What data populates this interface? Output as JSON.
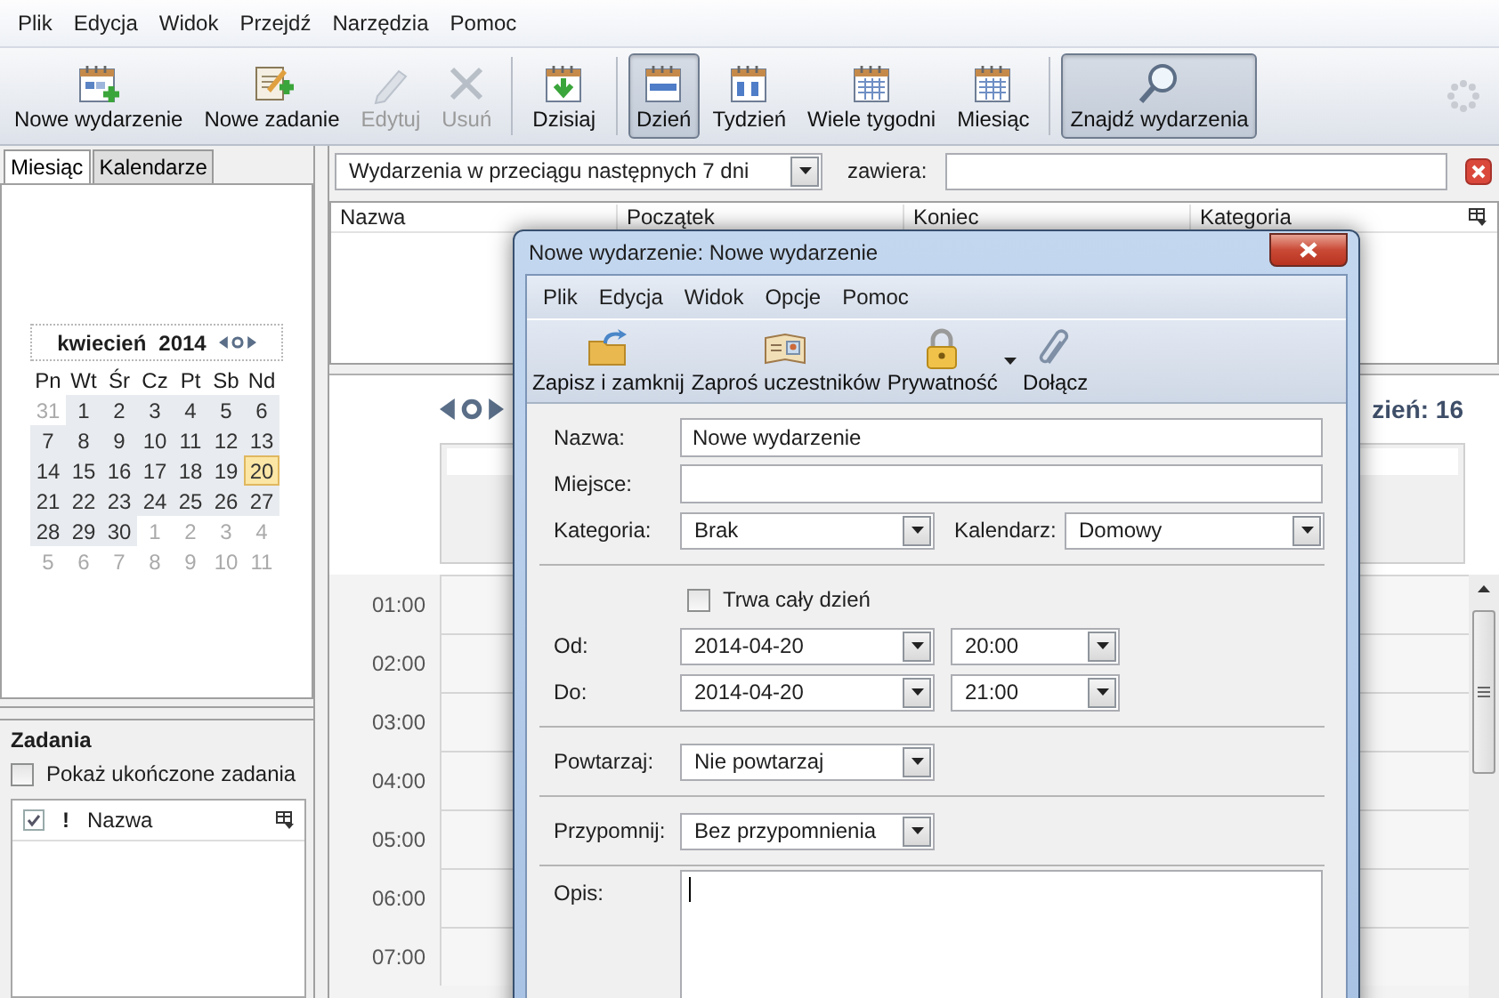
{
  "menu": [
    "Plik",
    "Edycja",
    "Widok",
    "Przejdź",
    "Narzędzia",
    "Pomoc"
  ],
  "toolbar": {
    "groups": [
      [
        {
          "label": "Nowe wydarzenie",
          "disabled": false,
          "selected": false
        },
        {
          "label": "Nowe zadanie",
          "disabled": false,
          "selected": false
        },
        {
          "label": "Edytuj",
          "disabled": true,
          "selected": false
        },
        {
          "label": "Usuń",
          "disabled": true,
          "selected": false
        }
      ],
      [
        {
          "label": "Dzisiaj",
          "disabled": false,
          "selected": false
        }
      ],
      [
        {
          "label": "Dzień",
          "disabled": false,
          "selected": true
        },
        {
          "label": "Tydzień",
          "disabled": false,
          "selected": false
        },
        {
          "label": "Wiele tygodni",
          "disabled": false,
          "selected": false
        },
        {
          "label": "Miesiąc",
          "disabled": false,
          "selected": false
        }
      ],
      [
        {
          "label": "Znajdź wydarzenia",
          "disabled": false,
          "selected": true
        }
      ]
    ]
  },
  "sidebar": {
    "tabs": [
      {
        "label": "Miesiąc",
        "selected": true
      },
      {
        "label": "Kalendarze",
        "selected": false
      }
    ],
    "minimonth": {
      "month": "kwiecień",
      "year": "2014",
      "weekdays": [
        "Pn",
        "Wt",
        "Śr",
        "Cz",
        "Pt",
        "Sb",
        "Nd"
      ],
      "weeks": [
        [
          {
            "day": "31",
            "outside": true,
            "selected": false
          },
          {
            "day": "1",
            "outside": false,
            "selected": false
          },
          {
            "day": "2",
            "outside": false,
            "selected": false
          },
          {
            "day": "3",
            "outside": false,
            "selected": false
          },
          {
            "day": "4",
            "outside": false,
            "selected": false
          },
          {
            "day": "5",
            "outside": false,
            "selected": false
          },
          {
            "day": "6",
            "outside": false,
            "selected": false
          }
        ],
        [
          {
            "day": "7",
            "outside": false,
            "selected": false
          },
          {
            "day": "8",
            "outside": false,
            "selected": false
          },
          {
            "day": "9",
            "outside": false,
            "selected": false
          },
          {
            "day": "10",
            "outside": false,
            "selected": false
          },
          {
            "day": "11",
            "outside": false,
            "selected": false
          },
          {
            "day": "12",
            "outside": false,
            "selected": false
          },
          {
            "day": "13",
            "outside": false,
            "selected": false
          }
        ],
        [
          {
            "day": "14",
            "outside": false,
            "selected": false
          },
          {
            "day": "15",
            "outside": false,
            "selected": false
          },
          {
            "day": "16",
            "outside": false,
            "selected": false
          },
          {
            "day": "17",
            "outside": false,
            "selected": false
          },
          {
            "day": "18",
            "outside": false,
            "selected": false
          },
          {
            "day": "19",
            "outside": false,
            "selected": false
          },
          {
            "day": "20",
            "outside": false,
            "selected": true
          }
        ],
        [
          {
            "day": "21",
            "outside": false,
            "selected": false
          },
          {
            "day": "22",
            "outside": false,
            "selected": false
          },
          {
            "day": "23",
            "outside": false,
            "selected": false
          },
          {
            "day": "24",
            "outside": false,
            "selected": false
          },
          {
            "day": "25",
            "outside": false,
            "selected": false
          },
          {
            "day": "26",
            "outside": false,
            "selected": false
          },
          {
            "day": "27",
            "outside": false,
            "selected": false
          }
        ],
        [
          {
            "day": "28",
            "outside": false,
            "selected": false
          },
          {
            "day": "29",
            "outside": false,
            "selected": false
          },
          {
            "day": "30",
            "outside": false,
            "selected": false
          },
          {
            "day": "1",
            "outside": true,
            "selected": false
          },
          {
            "day": "2",
            "outside": true,
            "selected": false
          },
          {
            "day": "3",
            "outside": true,
            "selected": false
          },
          {
            "day": "4",
            "outside": true,
            "selected": false
          }
        ],
        [
          {
            "day": "5",
            "outside": true,
            "selected": false
          },
          {
            "day": "6",
            "outside": true,
            "selected": false
          },
          {
            "day": "7",
            "outside": true,
            "selected": false
          },
          {
            "day": "8",
            "outside": true,
            "selected": false
          },
          {
            "day": "9",
            "outside": true,
            "selected": false
          },
          {
            "day": "10",
            "outside": true,
            "selected": false
          },
          {
            "day": "11",
            "outside": true,
            "selected": false
          }
        ]
      ]
    },
    "tasks": {
      "title": "Zadania",
      "show_completed": {
        "label": "Pokaż ukończone zadania",
        "checked": false
      },
      "priority_column": "!",
      "name_column": "Nazwa"
    }
  },
  "filter": {
    "value": "Wydarzenia w przeciągu następnych 7 dni",
    "contains_label": "zawiera:"
  },
  "event_list": {
    "columns": [
      "Nazwa",
      "Początek",
      "Koniec",
      "Kategoria"
    ]
  },
  "day_view": {
    "heading": "zień: 16",
    "hours": [
      "01:00",
      "02:00",
      "03:00",
      "04:00",
      "05:00",
      "06:00",
      "07:00"
    ]
  },
  "dialog": {
    "title": "Nowe wydarzenie: Nowe wydarzenie",
    "menu": [
      "Plik",
      "Edycja",
      "Widok",
      "Opcje",
      "Pomoc"
    ],
    "toolbar": [
      "Zapisz i zamknij",
      "Zaproś uczestników",
      "Prywatność",
      "Dołącz"
    ],
    "name": {
      "label": "Nazwa:",
      "value": "Nowe wydarzenie"
    },
    "location": {
      "label": "Miejsce:"
    },
    "category": {
      "label": "Kategoria:",
      "value": "Brak"
    },
    "calendar": {
      "label": "Kalendarz:",
      "value": "Domowy"
    },
    "all_day": {
      "label": "Trwa cały dzień",
      "checked": false
    },
    "start": {
      "label": "Od:",
      "date": "2014-04-20",
      "time": "20:00"
    },
    "end": {
      "label": "Do:",
      "date": "2014-04-20",
      "time": "21:00"
    },
    "repeat": {
      "label": "Powtarzaj:",
      "value": "Nie powtarzaj"
    },
    "reminder": {
      "label": "Przypomnij:",
      "value": "Bez przypomnienia"
    },
    "description": {
      "label": "Opis:"
    }
  }
}
